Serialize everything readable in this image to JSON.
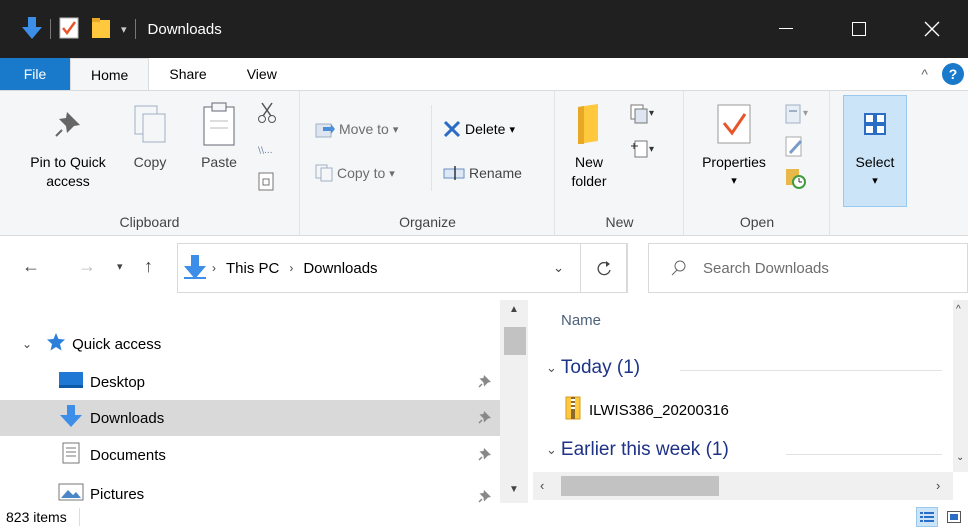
{
  "window": {
    "title": "Downloads"
  },
  "ribbon_tabs": [
    {
      "label": "File"
    },
    {
      "label": "Home"
    },
    {
      "label": "Share"
    },
    {
      "label": "View"
    }
  ],
  "ribbon": {
    "clipboard": {
      "pin_label_1": "Pin to Quick",
      "pin_label_2": "access",
      "copy": "Copy",
      "paste": "Paste",
      "label": "Clipboard"
    },
    "organize": {
      "move_to": "Move to",
      "copy_to": "Copy to",
      "delete": "Delete",
      "rename": "Rename",
      "label": "Organize"
    },
    "new": {
      "new_folder_1": "New",
      "new_folder_2": "folder",
      "label": "New"
    },
    "open": {
      "properties": "Properties",
      "label": "Open"
    },
    "select": {
      "label": "Select"
    }
  },
  "address": {
    "crumbs": [
      "This PC",
      "Downloads"
    ],
    "search_placeholder": "Search Downloads"
  },
  "nav": {
    "quick_access": "Quick access",
    "items": [
      {
        "label": "Desktop"
      },
      {
        "label": "Downloads"
      },
      {
        "label": "Documents"
      },
      {
        "label": "Pictures"
      }
    ]
  },
  "content": {
    "column_name": "Name",
    "groups": [
      {
        "label": "Today (1)"
      },
      {
        "label": "Earlier this week (1)"
      }
    ],
    "files": [
      {
        "name": "ILWIS386_20200316"
      }
    ]
  },
  "status": {
    "item_count": "823 items"
  },
  "colors": {
    "accent": "#1979ca",
    "titlebar": "#202020",
    "group_header": "#1e3287",
    "selection": "#cce4f7"
  }
}
